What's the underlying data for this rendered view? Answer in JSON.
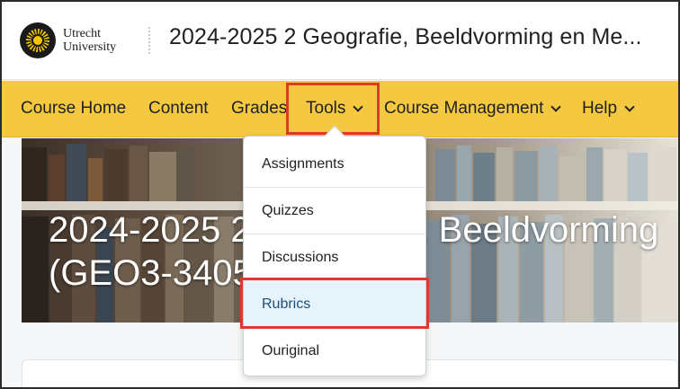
{
  "header": {
    "logo_line1": "Utrecht",
    "logo_line2": "University",
    "course_title": "2024-2025 2 Geografie, Beeldvorming en Me..."
  },
  "nav": {
    "items": [
      {
        "label": "Course Home",
        "has_dropdown": false
      },
      {
        "label": "Content",
        "has_dropdown": false
      },
      {
        "label": "Grades",
        "has_dropdown": false
      },
      {
        "label": "Tools",
        "has_dropdown": true
      },
      {
        "label": "Course Management",
        "has_dropdown": true
      },
      {
        "label": "Help",
        "has_dropdown": true
      }
    ]
  },
  "banner": {
    "title_line1": "2024-2025 2 Geografie, Beeldvorming",
    "title_line2": "(GEO3-3405)"
  },
  "tools_menu": {
    "items": [
      {
        "label": "Assignments"
      },
      {
        "label": "Quizzes"
      },
      {
        "label": "Discussions"
      },
      {
        "label": "Rubrics",
        "selected": true
      },
      {
        "label": "Ouriginal"
      }
    ]
  },
  "colors": {
    "navbar_bg": "#f5c842",
    "highlight": "#e0392c",
    "selected_bg": "#e6f3fa",
    "selected_text": "#1a4f7a"
  }
}
